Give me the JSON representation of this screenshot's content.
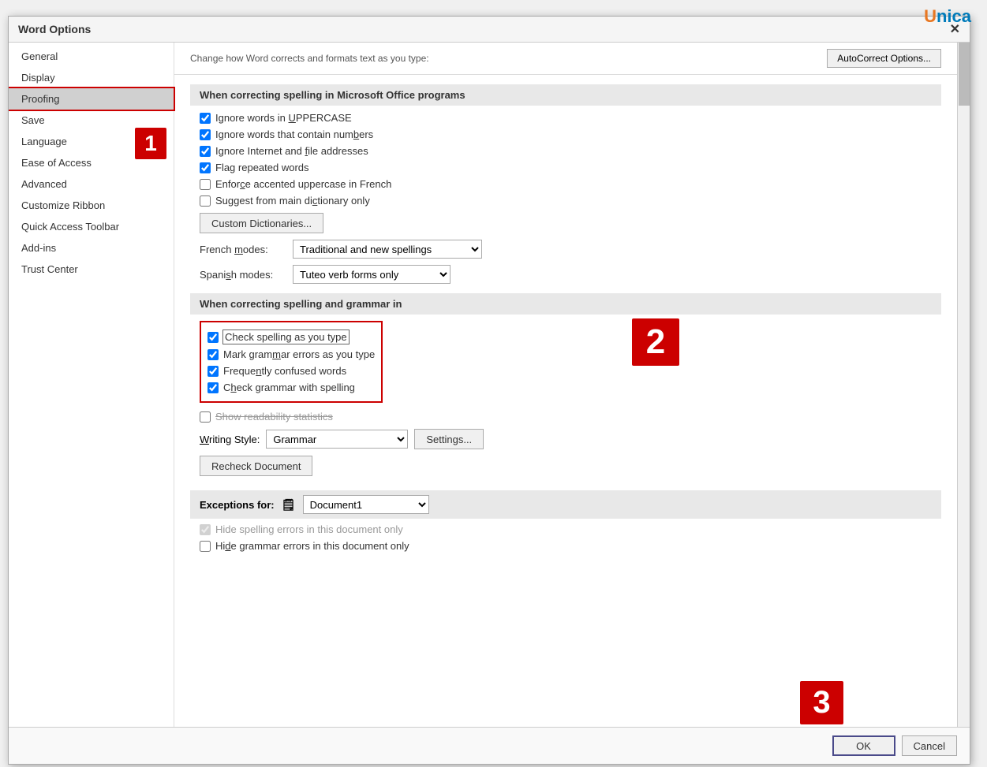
{
  "dialog": {
    "title": "Word Options"
  },
  "unica": {
    "text_u": "U",
    "text_nica": "nica"
  },
  "sidebar": {
    "items": [
      {
        "label": "General",
        "active": false
      },
      {
        "label": "Display",
        "active": false
      },
      {
        "label": "Proofing",
        "active": true
      },
      {
        "label": "Save",
        "active": false
      },
      {
        "label": "Language",
        "active": false
      },
      {
        "label": "Ease of Access",
        "active": false
      },
      {
        "label": "Advanced",
        "active": false
      },
      {
        "label": "Customize Ribbon",
        "active": false
      },
      {
        "label": "Quick Access Toolbar",
        "active": false
      },
      {
        "label": "Add-ins",
        "active": false
      },
      {
        "label": "Trust Center",
        "active": false
      }
    ]
  },
  "top_section": {
    "cut_text": "Change how Word corrects and formats text as you type:",
    "autocorrect_btn": "AutoCorrect Options..."
  },
  "ms_section": {
    "header": "When correcting spelling in Microsoft Office programs",
    "checkboxes": [
      {
        "label": "Ignore words in UPPERCASE",
        "checked": true,
        "id": "cb1"
      },
      {
        "label": "Ignore words that contain numbers",
        "checked": true,
        "id": "cb2"
      },
      {
        "label": "Ignore Internet and file addresses",
        "checked": true,
        "id": "cb3"
      },
      {
        "label": "Flag repeated words",
        "checked": true,
        "id": "cb4"
      },
      {
        "label": "Enforce accented uppercase in French",
        "checked": false,
        "id": "cb5"
      },
      {
        "label": "Suggest from main dictionary only",
        "checked": false,
        "id": "cb6"
      }
    ],
    "custom_dict_btn": "Custom Dictionaries...",
    "french_label": "French modes:",
    "french_value": "Traditional and new spellings",
    "spanish_label": "Spanish modes:",
    "spanish_value": "Tuteo verb forms only"
  },
  "grammar_section": {
    "header": "When correcting spelling and grammar in",
    "checkboxes": [
      {
        "label": "Check spelling as you type",
        "checked": true,
        "id": "cg1",
        "highlight": true
      },
      {
        "label": "Mark grammar errors as you type",
        "checked": true,
        "id": "cg2"
      },
      {
        "label": "Frequently confused words",
        "checked": true,
        "id": "cg3"
      },
      {
        "label": "Check grammar with spelling",
        "checked": true,
        "id": "cg4"
      },
      {
        "label": "Show readability statistics",
        "checked": false,
        "id": "cg5"
      }
    ],
    "writing_style_label": "Writing Style:",
    "writing_style_value": "Grammar",
    "settings_btn": "Settings...",
    "recheck_btn": "Recheck Document"
  },
  "exceptions": {
    "label": "Exceptions for:",
    "doc_name": "Document1",
    "checkboxes": [
      {
        "label": "Hide spelling errors in this document only",
        "checked": true,
        "id": "ce1",
        "disabled": true
      },
      {
        "label": "Hide grammar errors in this document only",
        "checked": false,
        "id": "ce2",
        "disabled": false
      }
    ]
  },
  "bottom": {
    "ok_label": "OK",
    "cancel_label": "Cancel"
  },
  "badges": {
    "b1": "1",
    "b2": "2",
    "b3": "3"
  }
}
